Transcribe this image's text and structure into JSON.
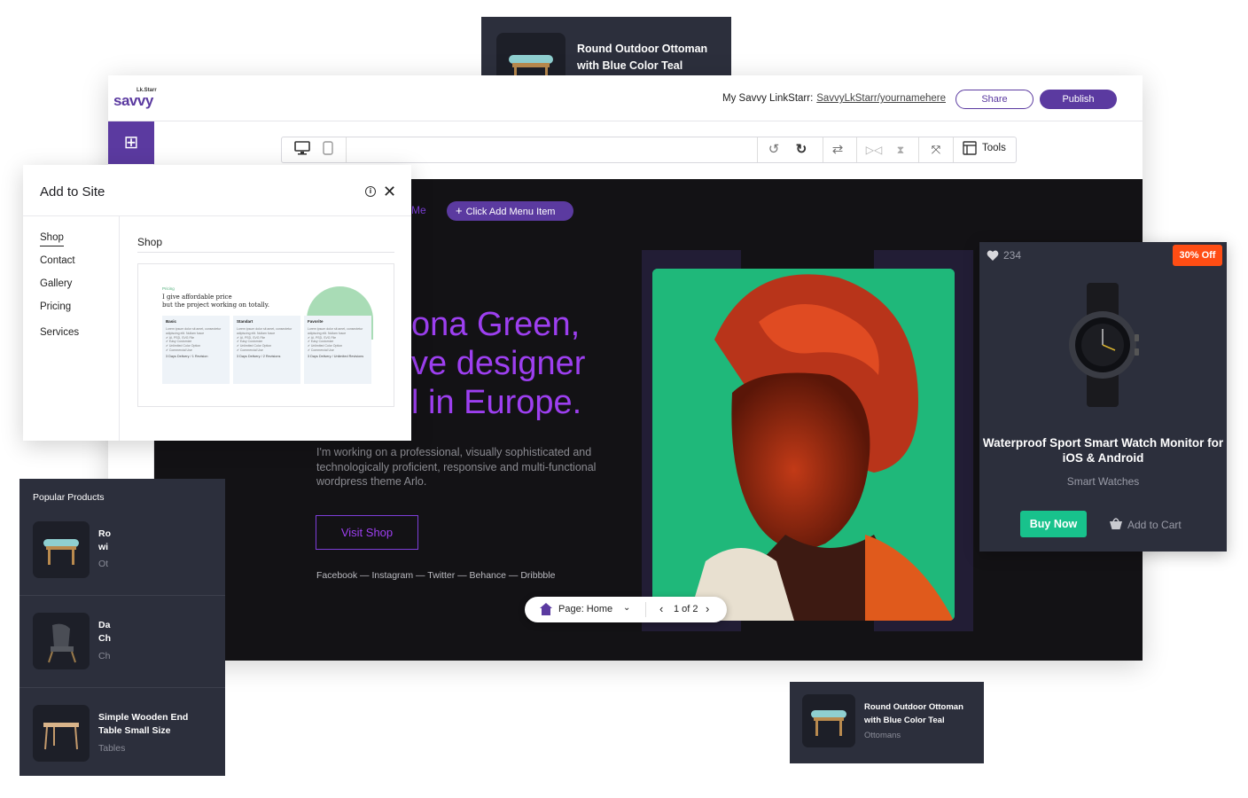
{
  "top_card": {
    "title": "Round Outdoor Ottoman with Blue Color Teal"
  },
  "header": {
    "logo_small": "Lk.Starr",
    "logo": "savvy",
    "linkstarr_label": "My Savvy LinkStarr:",
    "linkstarr_url": "SavvyLkStarr/yournamehere",
    "share_label": "Share",
    "publish_label": "Publish"
  },
  "rail": {
    "add_icon": "plus-icon",
    "rss_icon": "rss-icon",
    "avatar_icon": "user-icon"
  },
  "toolbar": {
    "icons": [
      "desktop-icon",
      "mobile-icon",
      "undo-icon",
      "redo-icon",
      "swap-icon",
      "flip-horizontal-icon",
      "flip-vertical-icon",
      "fullscreen-icon",
      "tools-icon"
    ],
    "tools_label": "Tools"
  },
  "canvas": {
    "menu_item_partial": "Me",
    "add_menu_label": "Click Add Menu Item",
    "hero_lines": [
      "ona Green,",
      "ve designer",
      "l in Europe."
    ],
    "paragraph": "I'm working on a professional, visually sophisticated and technologically proficient, responsive and multi-functional wordpress theme Arlo.",
    "visit_label": "Visit Shop",
    "socials": "Facebook — Instagram — Twitter — Behance — Dribbble",
    "accent": "#9d3ff0"
  },
  "pager": {
    "page_label": "Page: Home",
    "count": "1 of 2"
  },
  "add_panel": {
    "title": "Add to Site",
    "nav": [
      "Shop",
      "Contact",
      "Gallery",
      "Pricing",
      "Services"
    ],
    "active": "Shop",
    "section_title": "Shop",
    "preview": {
      "tag": "Pricing",
      "heading_1": "I give affordable price",
      "heading_2": "but the project working on totally.",
      "plans": [
        {
          "name": "Basic",
          "lines": [
            "Lorem ipsum dolor sit amet, consectetur",
            "adipiscing elit. Nullam fusce",
            "",
            "✔ AI, PSD, SVG File",
            "✔ Easy Customize",
            "✔ Unlimited Color Option",
            "✔ Commercial Use"
          ],
          "footer": "3 Days Delivery / 1 Revision"
        },
        {
          "name": "Standart",
          "lines": [
            "Lorem ipsum dolor sit amet, consectetur",
            "adipiscing elit. Nullam fusce",
            "",
            "✔ AI, PSD, SVG File",
            "✔ Easy Customize",
            "✔ Unlimited Color Option",
            "✔ Commercial Use"
          ],
          "footer": "3 Days Delivery / 2 Revisions"
        },
        {
          "name": "Favorite",
          "lines": [
            "Lorem ipsum dolor sit amet, consectetur",
            "adipiscing elit. Nullam fusce",
            "",
            "✔ AI, PSD, SVG File",
            "✔ Easy Customize",
            "✔ Unlimited Color Option",
            "✔ Commercial Use"
          ],
          "footer": "3 Days Delivery / Unlimited Revisions"
        }
      ]
    }
  },
  "watch_card": {
    "likes": "234",
    "badge": "30% Off",
    "title": "Waterproof Sport Smart Watch Monitor for iOS & Android",
    "category": "Smart Watches",
    "buy_label": "Buy Now",
    "cart_label": "Add to Cart",
    "badge_color": "#ff4d14",
    "buy_color": "#18c28c"
  },
  "popular": {
    "title": "Popular Products",
    "items": [
      {
        "name": "Round Outdoor Ottoman with Blue Color Teal",
        "name_visible": "Ro\nwi",
        "category_visible": "Ot"
      },
      {
        "name": "Danish Lounge Chair",
        "name_visible": "Da\nCh",
        "category_visible": "Ch"
      },
      {
        "name": "Simple Wooden End Table Small Size",
        "name_visible": "Simple Wooden End\nTable Small Size",
        "category_visible": "Tables"
      }
    ]
  },
  "bottom_card": {
    "title": "Round Outdoor Ottoman with Blue Color Teal",
    "category": "Ottomans"
  }
}
